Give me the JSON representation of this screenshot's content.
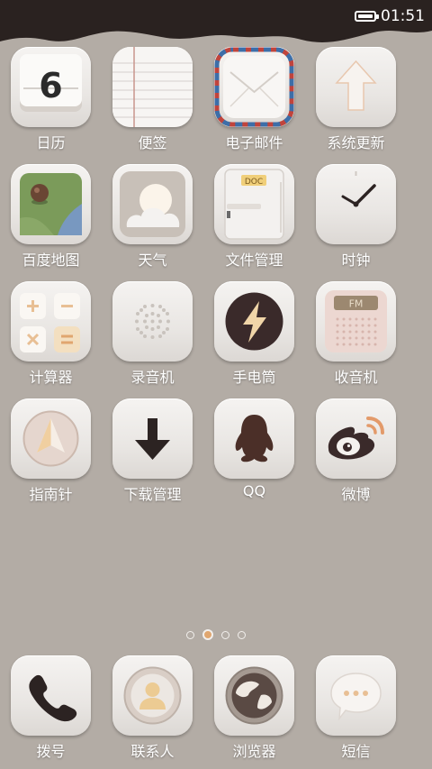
{
  "status_bar": {
    "time": "01:51",
    "battery_icon": "battery-full-icon"
  },
  "apps": [
    {
      "label": "日历",
      "icon": "calendar-icon",
      "day": "6"
    },
    {
      "label": "便签",
      "icon": "notepad-icon"
    },
    {
      "label": "电子邮件",
      "icon": "email-envelope-icon"
    },
    {
      "label": "系统更新",
      "icon": "update-arrow-icon"
    },
    {
      "label": "百度地图",
      "icon": "map-icon"
    },
    {
      "label": "天气",
      "icon": "weather-icon"
    },
    {
      "label": "文件管理",
      "icon": "file-cabinet-icon",
      "tag": "DOC"
    },
    {
      "label": "时钟",
      "icon": "clock-icon"
    },
    {
      "label": "计算器",
      "icon": "calculator-icon"
    },
    {
      "label": "录音机",
      "icon": "recorder-icon"
    },
    {
      "label": "手电筒",
      "icon": "flashlight-icon"
    },
    {
      "label": "收音机",
      "icon": "radio-icon",
      "tag": "FM"
    },
    {
      "label": "指南针",
      "icon": "compass-icon"
    },
    {
      "label": "下载管理",
      "icon": "download-icon"
    },
    {
      "label": "QQ",
      "icon": "qq-penguin-icon"
    },
    {
      "label": "微博",
      "icon": "weibo-icon"
    }
  ],
  "page_indicator": {
    "count": 4,
    "active": 1
  },
  "dock": [
    {
      "label": "拨号",
      "icon": "phone-icon"
    },
    {
      "label": "联系人",
      "icon": "contacts-icon"
    },
    {
      "label": "浏览器",
      "icon": "browser-globe-icon"
    },
    {
      "label": "短信",
      "icon": "sms-bubble-icon"
    }
  ],
  "colors": {
    "wallpaper": "#b3aca5",
    "top_wave": "#2a2220",
    "accent": "#e0a66f",
    "icon_dark": "#3a2a2a"
  }
}
